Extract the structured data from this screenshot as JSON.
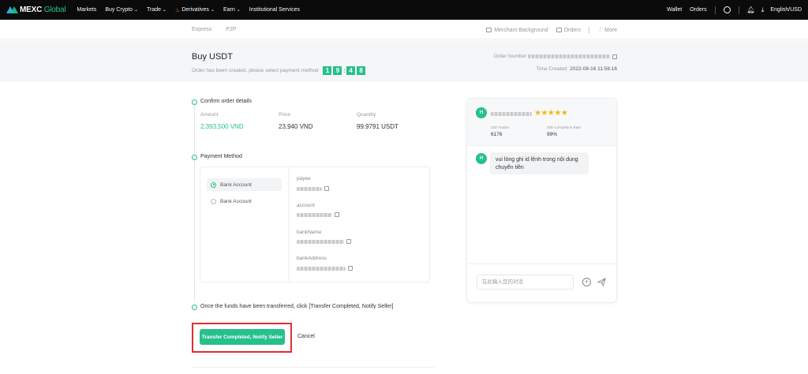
{
  "nav": {
    "logo_main": "MEXC",
    "logo_sub": "Global",
    "items": [
      {
        "label": "Markets",
        "chevron": false
      },
      {
        "label": "Buy Crypto",
        "chevron": true
      },
      {
        "label": "Trade",
        "chevron": true
      },
      {
        "label": "Derivatives",
        "chevron": true
      },
      {
        "label": "Earn",
        "chevron": true
      },
      {
        "label": "Institutional Services",
        "chevron": false
      }
    ],
    "wallet": "Wallet",
    "orders": "Orders",
    "language": "English/USD"
  },
  "subnav": {
    "express": "Express",
    "p2p": "P2P",
    "merchant": "Merchant Background",
    "orders": "Orders",
    "more": "More"
  },
  "header": {
    "title": "Buy USDT",
    "subtitle": "Order has been created, please select payment method",
    "timer": [
      "1",
      "9",
      "4",
      "8"
    ],
    "order_number_label": "Order Number",
    "time_created_label": "Time Created",
    "time_created": "2022-08-16 11:56:16"
  },
  "step1": {
    "title": "Confirm order details",
    "amount_label": "Amount",
    "amount": "2,393,500 VND",
    "price_label": "Price",
    "price": "23,940 VND",
    "quantity_label": "Quantity",
    "quantity": "99.9791 USDT"
  },
  "step2": {
    "title": "Payment Method",
    "options": [
      {
        "label": "Bank Account",
        "selected": true
      },
      {
        "label": "Bank Account",
        "selected": false
      }
    ],
    "fields": [
      {
        "label": "payee"
      },
      {
        "label": "account"
      },
      {
        "label": "bankName"
      },
      {
        "label": "bankAddress"
      }
    ]
  },
  "step3": {
    "title": "Once the funds have been transferred, click [Transfer Completed, Notify Seller]",
    "notify_button": "Transfer Completed, Notify Seller",
    "cancel": "Cancel"
  },
  "chat": {
    "avatar_letter": "H",
    "rating_stars": "★★★★★",
    "trades_label": "30D Trades",
    "trades": "6176",
    "completion_label": "30D Completion Rate",
    "completion": "99%",
    "message": "vui lòng ghi id lệnh trong nội dung chuyển tiền",
    "input_placeholder": "在此输入您的对话"
  },
  "colors": {
    "accent": "#26c08b",
    "highlight": "#e32d2d",
    "star": "#f0b90b"
  }
}
